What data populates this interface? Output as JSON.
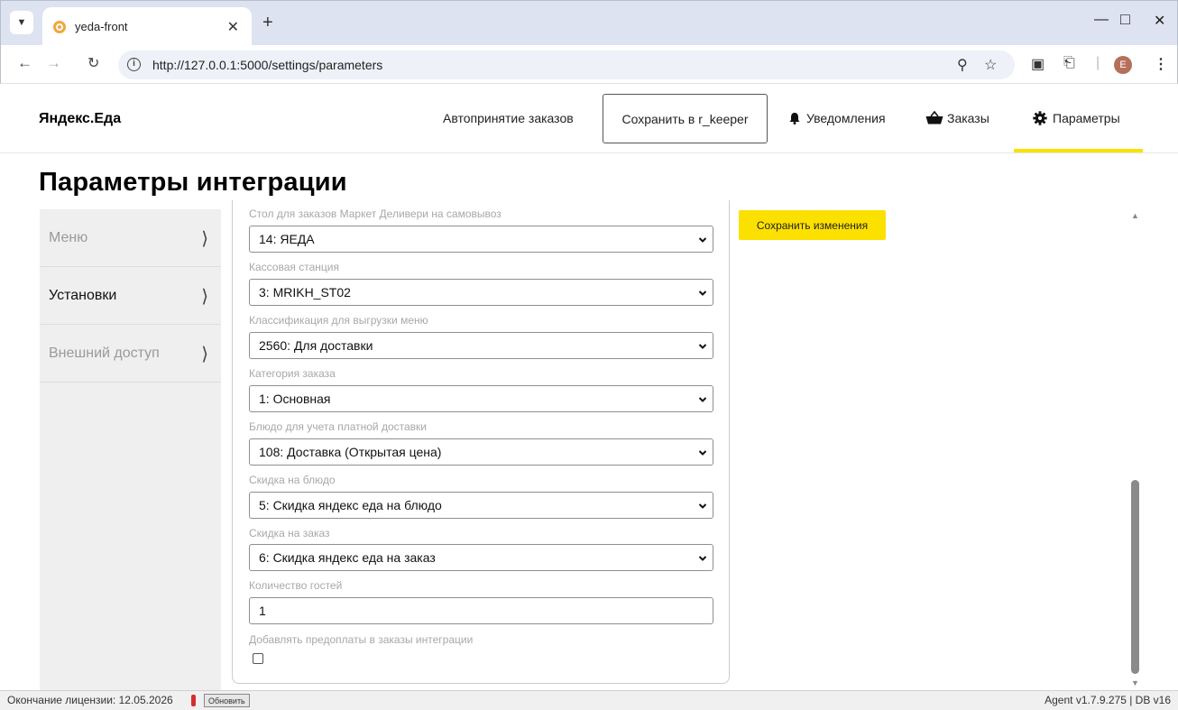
{
  "browser": {
    "tab_title": "yeda-front",
    "url": "http://127.0.0.1:5000/settings/parameters",
    "profile_initial": "E"
  },
  "header": {
    "brand": "Яндекс.Еда",
    "nav": {
      "auto_accept": "Автопринятие заказов",
      "save_rkeeper": "Сохранить в r_keeper",
      "notifications": "Уведомления",
      "orders": "Заказы",
      "parameters": "Параметры"
    },
    "active_tab": "parameters",
    "accent_color": "#fce000"
  },
  "page": {
    "title": "Параметры интеграции"
  },
  "sidebar": {
    "items": [
      {
        "label": "Меню",
        "active": false
      },
      {
        "label": "Установки",
        "active": true
      },
      {
        "label": "Внешний доступ",
        "active": false
      }
    ]
  },
  "form": {
    "fields": [
      {
        "label": "Стол для заказов Маркет Деливери на самовывоз",
        "value": "14: ЯЕДА"
      },
      {
        "label": "Кассовая станция",
        "value": "3: MRIKH_ST02"
      },
      {
        "label": "Классификация для выгрузки меню",
        "value": "2560: Для доставки"
      },
      {
        "label": "Категория заказа",
        "value": "1: Основная"
      },
      {
        "label": "Блюдо для учета платной доставки",
        "value": "108: Доставка (Открытая цена)"
      },
      {
        "label": "Скидка на блюдо",
        "value": "5: Скидка яндекс еда на блюдо"
      },
      {
        "label": "Скидка на заказ",
        "value": "6: Скидка яндекс еда на заказ"
      }
    ],
    "guests": {
      "label": "Количество гостей",
      "value": "1"
    },
    "prepay": {
      "label": "Добавлять предоплаты в заказы интеграции",
      "checked": false
    },
    "save_button": "Сохранить изменения"
  },
  "status": {
    "license": "Окончание лицензии: 12.05.2026",
    "refresh_button": "Обновить",
    "version": "Agent v1.7.9.275  |  DB v16"
  }
}
